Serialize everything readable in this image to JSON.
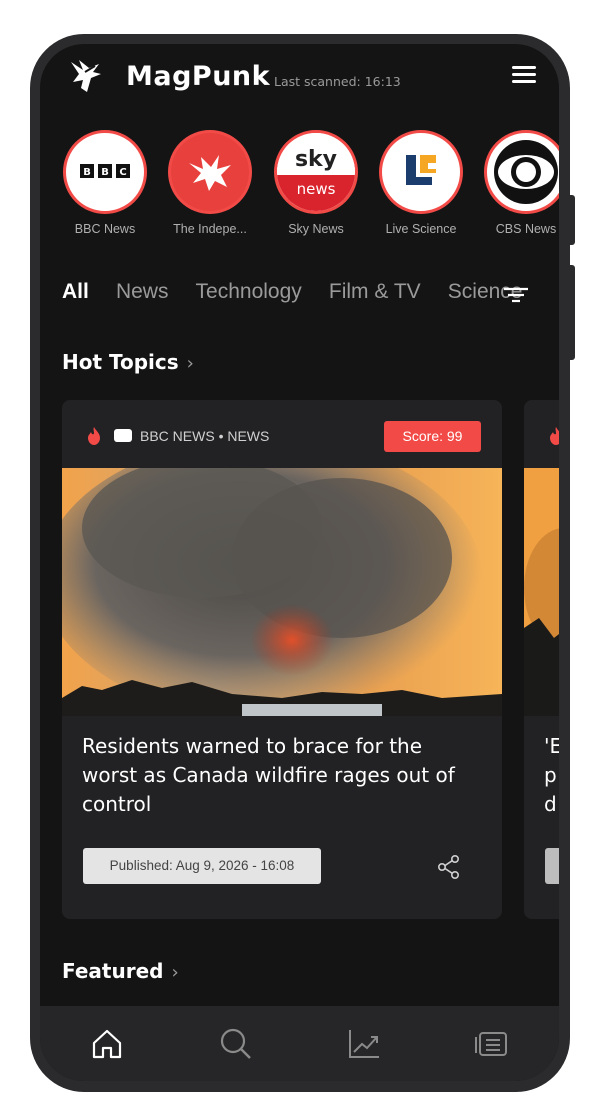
{
  "header": {
    "app_title": "MagPunk",
    "last_scanned": "Last scanned: 16:13",
    "logo_icon": "bird-logo-icon",
    "menu_icon": "hamburger-menu-icon"
  },
  "sources": [
    {
      "label": "BBC News",
      "icon": "bbc-logo"
    },
    {
      "label": "The Indepe...",
      "icon": "independent-eagle-logo"
    },
    {
      "label": "Sky News",
      "icon": "sky-news-logo"
    },
    {
      "label": "Live Science",
      "icon": "live-science-logo"
    },
    {
      "label": "CBS News",
      "icon": "cbs-eye-logo"
    }
  ],
  "tabs": [
    {
      "label": "All",
      "active": true
    },
    {
      "label": "News",
      "active": false
    },
    {
      "label": "Technology",
      "active": false
    },
    {
      "label": "Film & TV",
      "active": false
    },
    {
      "label": "Science",
      "active": false
    }
  ],
  "hot_topics": {
    "title": "Hot Topics",
    "card": {
      "meta": "BBC NEWS • NEWS",
      "score": "Score: 99",
      "headline": "Residents warned to brace for the worst as Canada wildfire rages out of control",
      "published": "Published: Aug 9, 2026 - 16:08"
    },
    "card2_headline": "'E p d"
  },
  "featured": {
    "title": "Featured"
  },
  "colors": {
    "accent": "#f24b47",
    "background": "#141414",
    "card": "#222224",
    "frame": "#2b2b2d"
  },
  "nav": [
    "home-icon",
    "search-icon",
    "trending-chart-icon",
    "news-feed-icon"
  ]
}
